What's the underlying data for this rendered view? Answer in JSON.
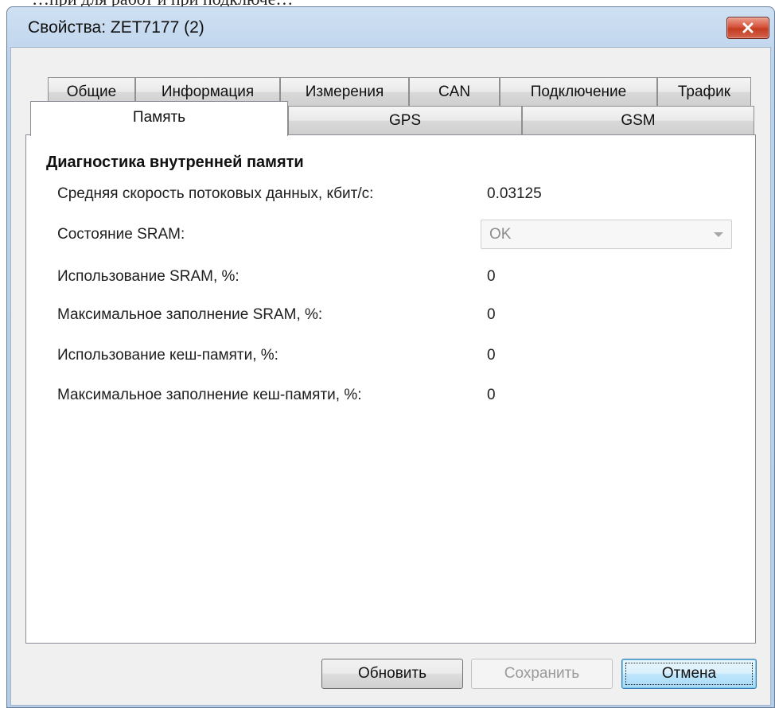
{
  "background_text": "…при для работ и при подключе…",
  "window": {
    "title": "Свойства: ZET7177 (2)",
    "close_icon": "close-x-icon"
  },
  "tabs": {
    "row_back": [
      "Общие",
      "Информация",
      "Измерения",
      "CAN",
      "Подключение",
      "Трафик"
    ],
    "row_front": [
      "Память",
      "GPS",
      "GSM"
    ],
    "selected": "Память"
  },
  "memory": {
    "group_title": "Диагностика внутренней памяти",
    "rows": [
      {
        "label": "Средняя скорость потоковых данных, кбит/с:",
        "value": "0.03125"
      },
      {
        "label": "Состояние SRAM:",
        "value": "OK"
      },
      {
        "label": "Использование SRAM, %:",
        "value": "0"
      },
      {
        "label": "Максимальное заполнение SRAM, %:",
        "value": "0"
      },
      {
        "label": "Использование кеш-памяти, %:",
        "value": "0"
      },
      {
        "label": "Максимальное заполнение кеш-памяти, %:",
        "value": "0"
      }
    ]
  },
  "buttons": {
    "refresh": "Обновить",
    "save": "Сохранить",
    "cancel": "Отмена"
  },
  "colors": {
    "titlebar": "#bcd3ec",
    "close_button": "#c43c22",
    "default_button_border": "#3c7fb1"
  }
}
